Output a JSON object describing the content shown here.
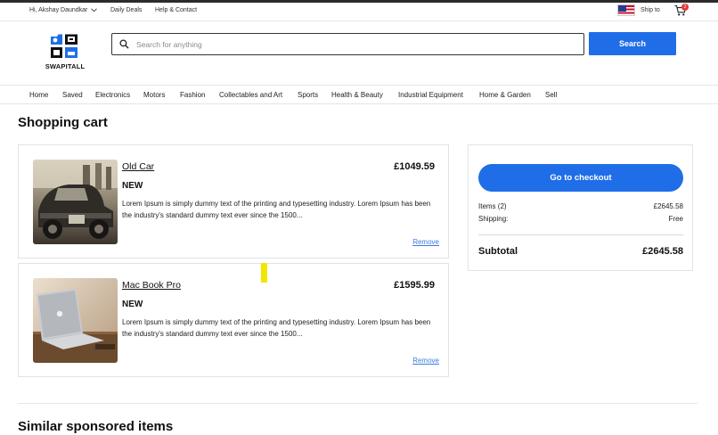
{
  "util_bar": {
    "greeting": "Hi, Akshay Daundkar",
    "daily_deals": "Daily Deals",
    "help_contact": "Help & Contact",
    "ship_to": "Ship to",
    "cart_count": "2"
  },
  "logo": {
    "text": "SWAPITALL"
  },
  "search": {
    "placeholder": "Search for anything",
    "button_label": "Search"
  },
  "nav": {
    "items": [
      "Home",
      "Saved",
      "Electronics",
      "Motors",
      "Fashion",
      "Collectables and Art",
      "Sports",
      "Health & Beauty",
      "Industrial Equipment",
      "Home & Garden",
      "Sell"
    ]
  },
  "page_title": "Shopping cart",
  "cart_items": [
    {
      "name": "Old Car",
      "price": "£1049.59",
      "condition": "NEW",
      "description": "Lorem Ipsum is simply dummy text of the printing and typesetting industry. Lorem Ipsum has been the industry's standard dummy text ever since the 1500...",
      "remove_label": "Remove"
    },
    {
      "name": "Mac Book Pro",
      "price": "£1595.99",
      "condition": "NEW",
      "description": "Lorem Ipsum is simply dummy text of the printing and typesetting industry. Lorem Ipsum has been the industry's standard dummy text ever since the 1500...",
      "remove_label": "Remove"
    }
  ],
  "summary": {
    "checkout_label": "Go to checkout",
    "items_label": "Items (2)",
    "items_value": "£2645.58",
    "shipping_label": "Shipping:",
    "shipping_value": "Free",
    "subtotal_label": "Subtotal",
    "subtotal_value": "£2645.58"
  },
  "similar_title": "Similar sponsored items",
  "colors": {
    "accent": "#1f6ee8",
    "link": "#3b7ddd",
    "badge": "#e23b3b",
    "marker": "#f2e600"
  }
}
